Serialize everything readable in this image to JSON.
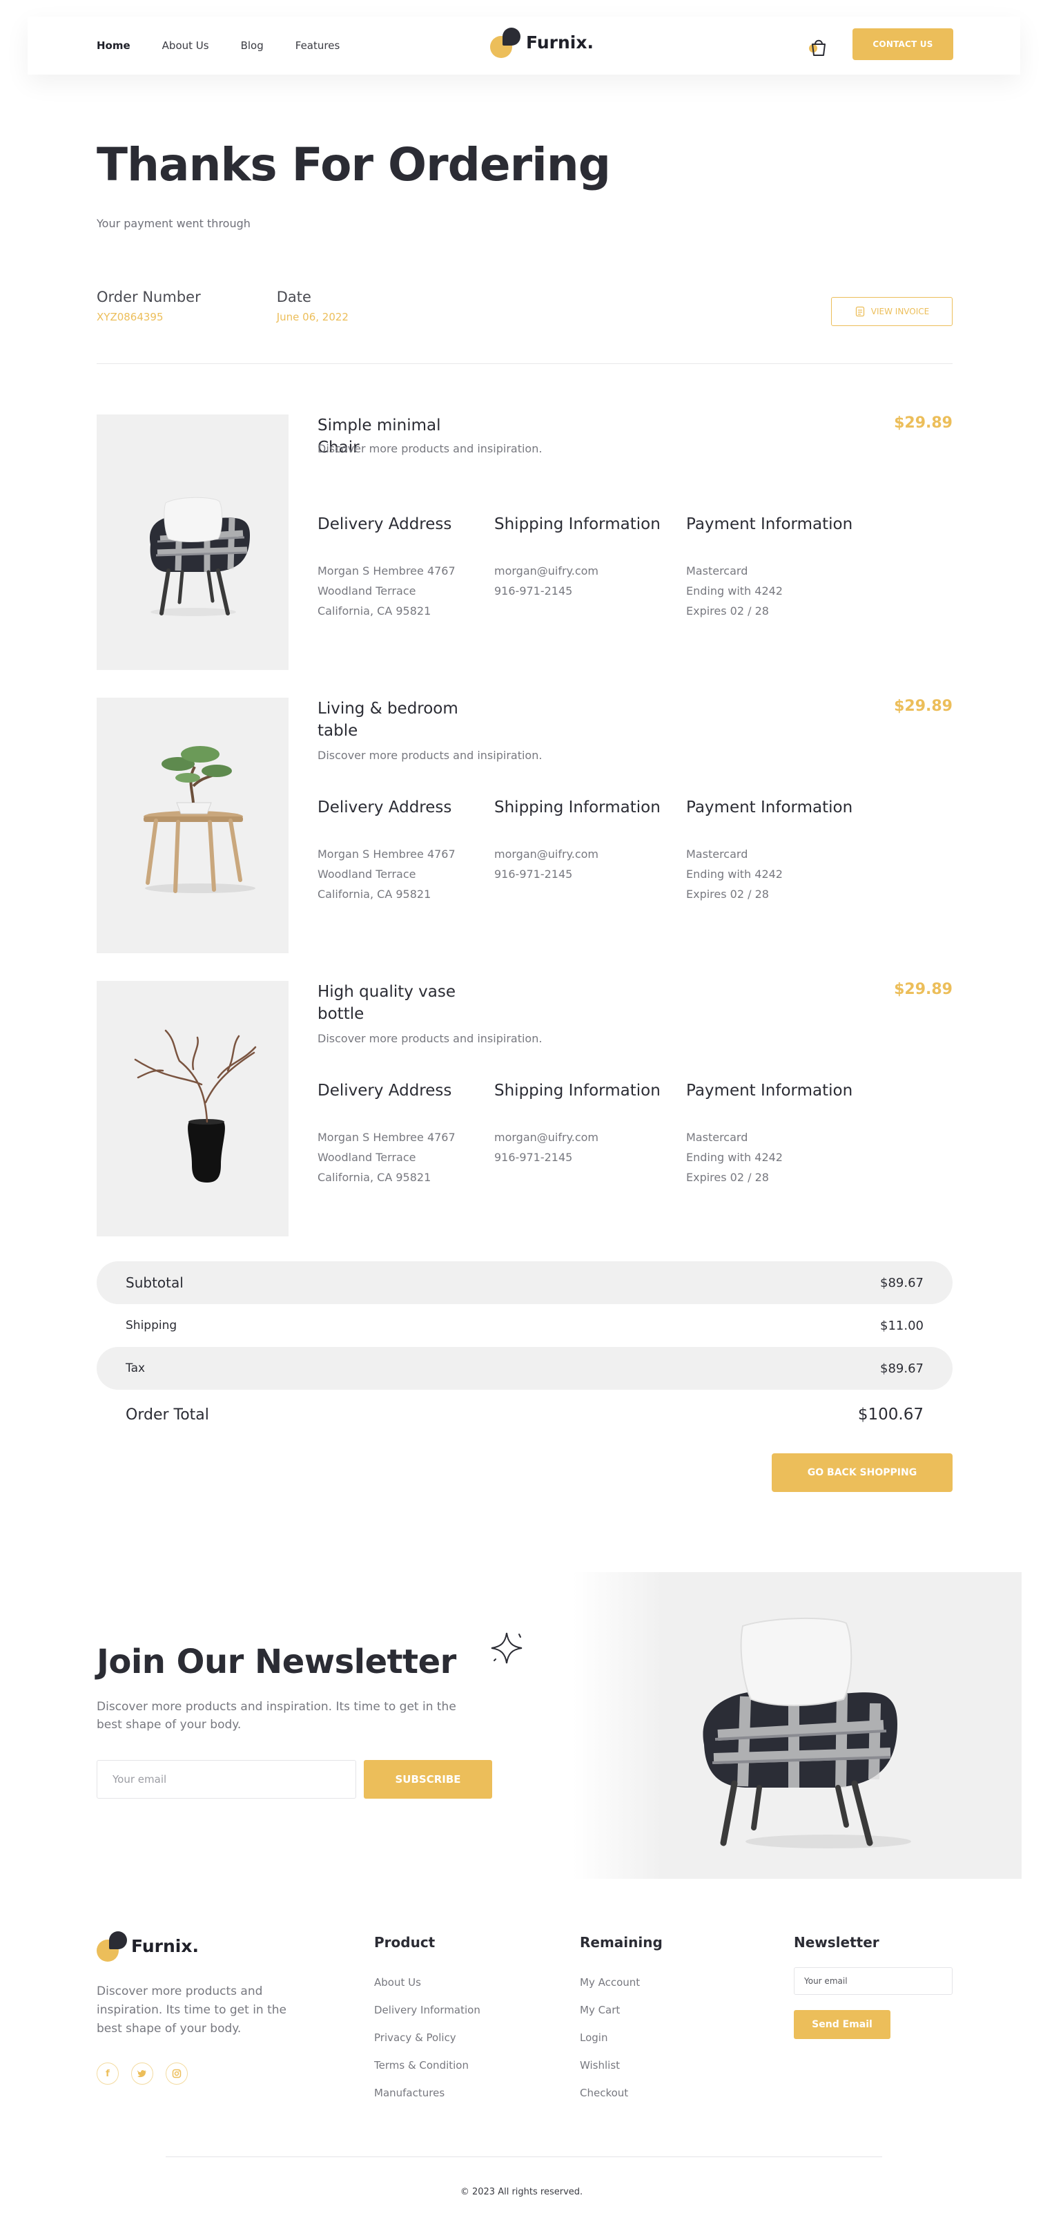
{
  "colors": {
    "accent": "#ecbe5a",
    "text_dark": "#2b2c34",
    "text_muted": "#77787f",
    "panel_bg": "#f0f0f0"
  },
  "header": {
    "nav": [
      "Home",
      "About Us",
      "Blog",
      "Features"
    ],
    "brand": "Furnix.",
    "cart_icon": "shopping-bag-icon",
    "contact_label": "CONTACT US"
  },
  "hero": {
    "title": "Thanks For Ordering",
    "subtitle": "Your payment went through"
  },
  "order": {
    "number_label": "Order Number",
    "number_value": "XYZ0864395",
    "date_label": "Date",
    "date_value": "June 06, 2022",
    "invoice_label": "VIEW INVOICE"
  },
  "products": [
    {
      "name": "Simple minimal Chair",
      "desc": "Discover more products and insipiration.",
      "price": "$29.89",
      "image": "armchair-image",
      "delivery": {
        "title": "Delivery Address",
        "lines": [
          "Morgan S Hembree 4767",
          "Woodland Terrace",
          "California, CA 95821"
        ]
      },
      "shipping": {
        "title": "Shipping Information",
        "lines": [
          "morgan@uifry.com",
          "916-971-2145"
        ]
      },
      "payment": {
        "title": "Payment Information",
        "lines": [
          "Mastercard",
          "Ending with 4242",
          "Expires 02 / 28"
        ]
      }
    },
    {
      "name": "Living & bedroom table",
      "desc": "Discover more products and insipiration.",
      "price": "$29.89",
      "image": "bonsai-table-image",
      "delivery": {
        "title": "Delivery Address",
        "lines": [
          "Morgan S Hembree 4767",
          "Woodland Terrace",
          "California, CA 95821"
        ]
      },
      "shipping": {
        "title": "Shipping Information",
        "lines": [
          "morgan@uifry.com",
          "916-971-2145"
        ]
      },
      "payment": {
        "title": "Payment Information",
        "lines": [
          "Mastercard",
          "Ending with 4242",
          "Expires 02 / 28"
        ]
      }
    },
    {
      "name": "High quality vase bottle",
      "desc": "Discover more products and insipiration.",
      "price": "$29.89",
      "image": "vase-image",
      "delivery": {
        "title": "Delivery Address",
        "lines": [
          "Morgan S Hembree 4767",
          "Woodland Terrace",
          "California, CA 95821"
        ]
      },
      "shipping": {
        "title": "Shipping Information",
        "lines": [
          "morgan@uifry.com",
          "916-971-2145"
        ]
      },
      "payment": {
        "title": "Payment Information",
        "lines": [
          "Mastercard",
          "Ending with 4242",
          "Expires 02 / 28"
        ]
      }
    }
  ],
  "totals": {
    "subtotal_label": "Subtotal",
    "subtotal_value": "$89.67",
    "shipping_label": "Shipping",
    "shipping_value": "$11.00",
    "tax_label": "Tax",
    "tax_value": "$89.67",
    "total_label": "Order Total",
    "total_value": "$100.67",
    "back_label": "GO BACK SHOPPING"
  },
  "newsletter": {
    "title": "Join Our Newsletter",
    "desc": "Discover more products and inspiration. Its time to get in the best shape of your body.",
    "placeholder": "Your email",
    "button": "SUBSCRIBE"
  },
  "footer": {
    "brand": "Furnix.",
    "desc": "Discover more products and inspiration. Its time to get in the best shape of your body.",
    "socials": [
      "facebook-icon",
      "twitter-icon",
      "instagram-icon"
    ],
    "product": {
      "title": "Product",
      "links": [
        "About Us",
        "Delivery Information",
        "Privacy & Policy",
        "Terms & Condition",
        "Manufactures"
      ]
    },
    "remaining": {
      "title": "Remaining",
      "links": [
        "My Account",
        "My Cart",
        "Login",
        "Wishlist",
        "Checkout"
      ]
    },
    "newsletter": {
      "title": "Newsletter",
      "placeholder": "Your email",
      "button": "Send Email"
    },
    "copyright": "© 2023 All rights reserved."
  }
}
